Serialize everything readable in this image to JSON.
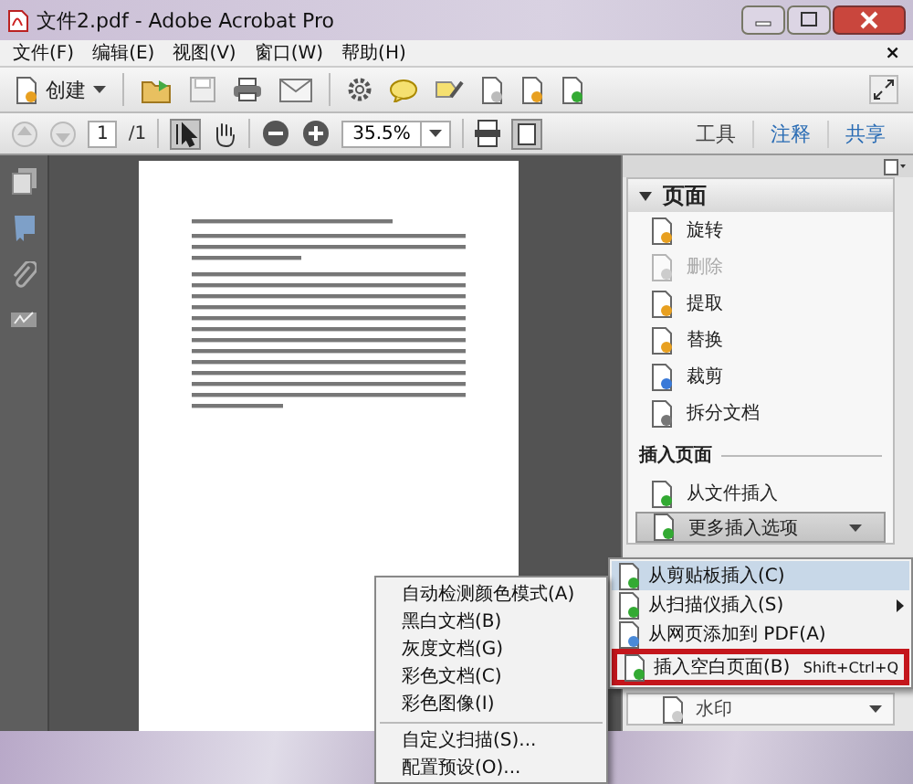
{
  "window": {
    "title": "文件2.pdf - Adobe Acrobat Pro"
  },
  "menu_bar": {
    "items": [
      "文件(F)",
      "编辑(E)",
      "视图(V)",
      "窗口(W)",
      "帮助(H)"
    ],
    "close": "×"
  },
  "toolbar": {
    "create_label": "创建"
  },
  "nav_bar": {
    "page": "1",
    "total": "/1",
    "zoom": "35.5%",
    "tabs": [
      {
        "label": "工具",
        "selected": true
      },
      {
        "label": "注释",
        "selected": false
      },
      {
        "label": "共享",
        "selected": false
      }
    ]
  },
  "tools_panel": {
    "section": {
      "title": "页面",
      "expanded": true,
      "items": [
        {
          "label": "旋转",
          "disabled": false
        },
        {
          "label": "删除",
          "disabled": true
        },
        {
          "label": "提取",
          "disabled": false
        },
        {
          "label": "替换",
          "disabled": false
        },
        {
          "label": "裁剪",
          "disabled": false
        },
        {
          "label": "拆分文档",
          "disabled": false
        }
      ]
    },
    "insert_heading": "插入页面",
    "insert_items": [
      {
        "label": "从文件插入",
        "kind": "item"
      },
      {
        "label": "更多插入选项",
        "kind": "dropdown"
      }
    ],
    "watermark": "水印"
  },
  "insert_menu": {
    "items": [
      {
        "label": "从剪贴板插入(C)",
        "selected": true,
        "submenu": false,
        "framed": false
      },
      {
        "label": "从扫描仪插入(S)",
        "selected": false,
        "submenu": true,
        "framed": false
      },
      {
        "label": "从网页添加到 PDF(A)",
        "selected": false,
        "submenu": false,
        "framed": false
      },
      {
        "label": "插入空白页面(B)",
        "shortcut": "Shift+Ctrl+Q",
        "selected": false,
        "submenu": false,
        "framed": true
      }
    ]
  },
  "scan_menu": {
    "groups": [
      [
        "自动检测颜色模式(A)",
        "黑白文档(B)",
        "灰度文档(G)",
        "彩色文档(C)",
        "彩色图像(I)"
      ],
      [
        "自定义扫描(S)...",
        "配置预设(O)..."
      ]
    ]
  }
}
